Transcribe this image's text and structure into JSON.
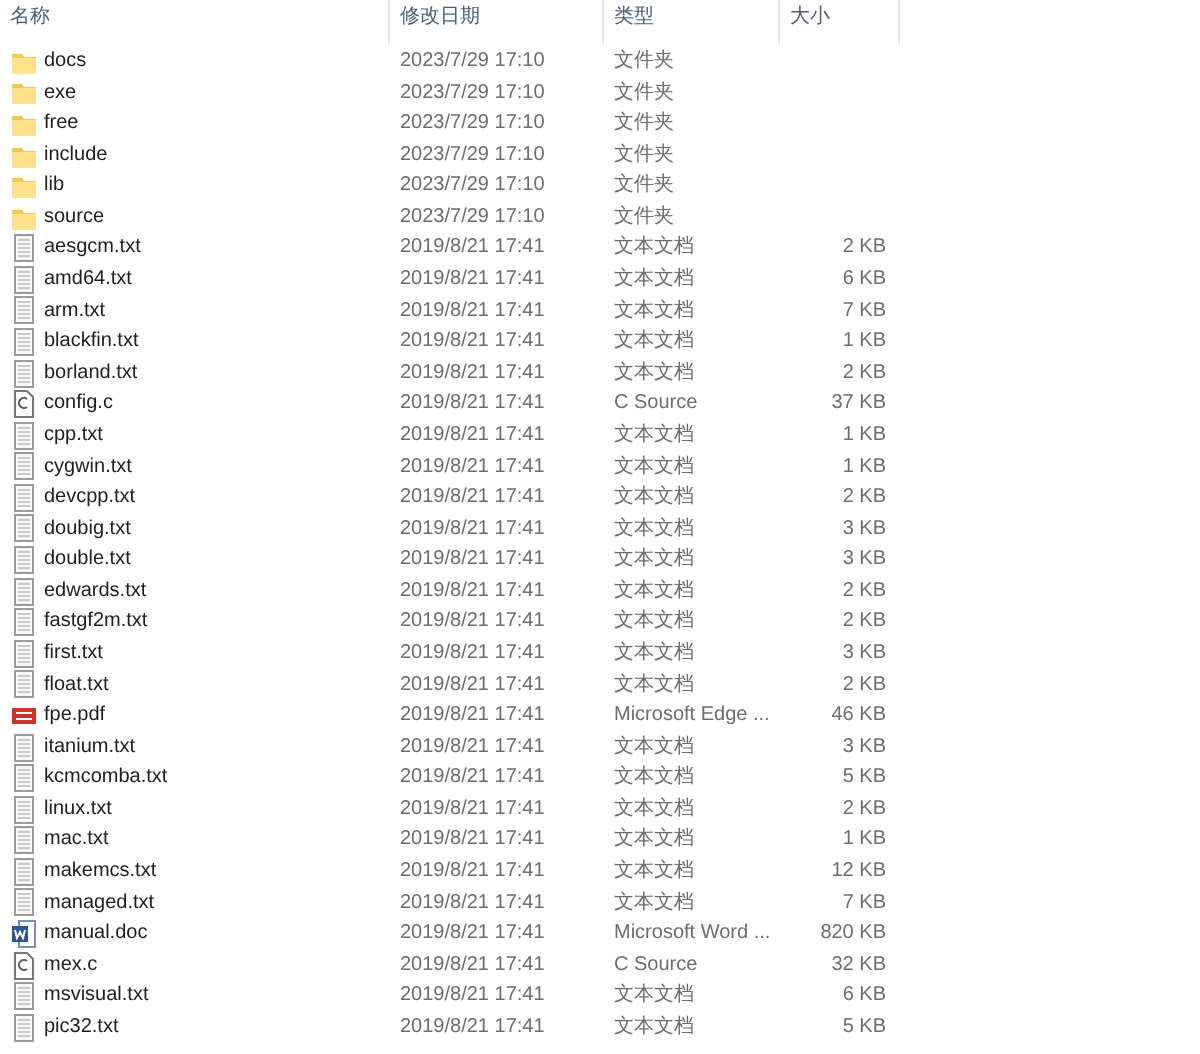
{
  "columns": [
    "名称",
    "修改日期",
    "类型",
    "大小"
  ],
  "files": [
    {
      "name": "docs",
      "date": "2023/7/29 17:10",
      "type": "文件夹",
      "kind": "folder"
    },
    {
      "name": "exe",
      "date": "2023/7/29 17:10",
      "type": "文件夹",
      "kind": "folder"
    },
    {
      "name": "free",
      "date": "2023/7/29 17:10",
      "type": "文件夹",
      "kind": "folder"
    },
    {
      "name": "include",
      "date": "2023/7/29 17:10",
      "type": "文件夹",
      "kind": "folder"
    },
    {
      "name": "lib",
      "date": "2023/7/29 17:10",
      "type": "文件夹",
      "kind": "folder"
    },
    {
      "name": "source",
      "date": "2023/7/29 17:10",
      "type": "文件夹",
      "kind": "folder"
    },
    {
      "name": "aesgcm.txt",
      "date": "2019/8/21 17:41",
      "type": "文本文档",
      "size": "2 KB",
      "kind": "text"
    },
    {
      "name": "amd64.txt",
      "date": "2019/8/21 17:41",
      "type": "文本文档",
      "size": "6 KB",
      "kind": "text"
    },
    {
      "name": "arm.txt",
      "date": "2019/8/21 17:41",
      "type": "文本文档",
      "size": "7 KB",
      "kind": "text"
    },
    {
      "name": "blackfin.txt",
      "date": "2019/8/21 17:41",
      "type": "文本文档",
      "size": "1 KB",
      "kind": "text"
    },
    {
      "name": "borland.txt",
      "date": "2019/8/21 17:41",
      "type": "文本文档",
      "size": "2 KB",
      "kind": "text"
    },
    {
      "name": "config.c",
      "date": "2019/8/21 17:41",
      "type": "C Source",
      "size": "37 KB",
      "kind": "c"
    },
    {
      "name": "cpp.txt",
      "date": "2019/8/21 17:41",
      "type": "文本文档",
      "size": "1 KB",
      "kind": "text"
    },
    {
      "name": "cygwin.txt",
      "date": "2019/8/21 17:41",
      "type": "文本文档",
      "size": "1 KB",
      "kind": "text"
    },
    {
      "name": "devcpp.txt",
      "date": "2019/8/21 17:41",
      "type": "文本文档",
      "size": "2 KB",
      "kind": "text"
    },
    {
      "name": "doubig.txt",
      "date": "2019/8/21 17:41",
      "type": "文本文档",
      "size": "3 KB",
      "kind": "text"
    },
    {
      "name": "double.txt",
      "date": "2019/8/21 17:41",
      "type": "文本文档",
      "size": "3 KB",
      "kind": "text"
    },
    {
      "name": "edwards.txt",
      "date": "2019/8/21 17:41",
      "type": "文本文档",
      "size": "2 KB",
      "kind": "text"
    },
    {
      "name": "fastgf2m.txt",
      "date": "2019/8/21 17:41",
      "type": "文本文档",
      "size": "2 KB",
      "kind": "text"
    },
    {
      "name": "first.txt",
      "date": "2019/8/21 17:41",
      "type": "文本文档",
      "size": "3 KB",
      "kind": "text"
    },
    {
      "name": "float.txt",
      "date": "2019/8/21 17:41",
      "type": "文本文档",
      "size": "2 KB",
      "kind": "text"
    },
    {
      "name": "fpe.pdf",
      "date": "2019/8/21 17:41",
      "type": "Microsoft Edge ...",
      "size": "46 KB",
      "kind": "pdf"
    },
    {
      "name": "itanium.txt",
      "date": "2019/8/21 17:41",
      "type": "文本文档",
      "size": "3 KB",
      "kind": "text"
    },
    {
      "name": "kcmcomba.txt",
      "date": "2019/8/21 17:41",
      "type": "文本文档",
      "size": "5 KB",
      "kind": "text"
    },
    {
      "name": "linux.txt",
      "date": "2019/8/21 17:41",
      "type": "文本文档",
      "size": "2 KB",
      "kind": "text"
    },
    {
      "name": "mac.txt",
      "date": "2019/8/21 17:41",
      "type": "文本文档",
      "size": "1 KB",
      "kind": "text"
    },
    {
      "name": "makemcs.txt",
      "date": "2019/8/21 17:41",
      "type": "文本文档",
      "size": "12 KB",
      "kind": "text"
    },
    {
      "name": "managed.txt",
      "date": "2019/8/21 17:41",
      "type": "文本文档",
      "size": "7 KB",
      "kind": "text"
    },
    {
      "name": "manual.doc",
      "date": "2019/8/21 17:41",
      "type": "Microsoft Word ...",
      "size": "820 KB",
      "kind": "word"
    },
    {
      "name": "mex.c",
      "date": "2019/8/21 17:41",
      "type": "C Source",
      "size": "32 KB",
      "kind": "c"
    },
    {
      "name": "msvisual.txt",
      "date": "2019/8/21 17:41",
      "type": "文本文档",
      "size": "6 KB",
      "kind": "text"
    },
    {
      "name": "pic32.txt",
      "date": "2019/8/21 17:41",
      "type": "文本文档",
      "size": "5 KB",
      "kind": "text"
    }
  ]
}
